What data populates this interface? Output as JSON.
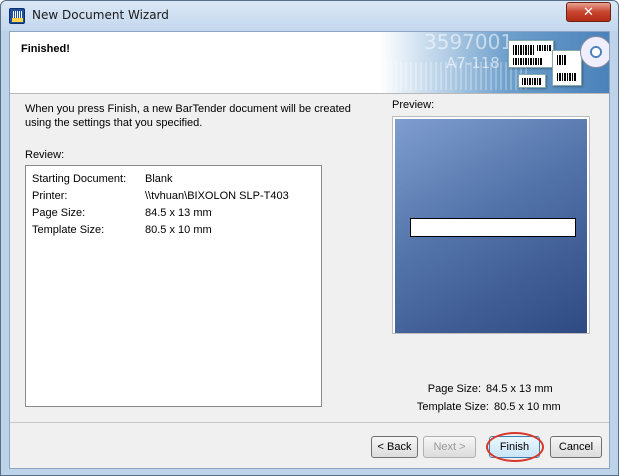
{
  "window": {
    "title": "New Document Wizard",
    "close_glyph": "✕"
  },
  "header": {
    "title": "Finished!",
    "banner_text_1": "3597001",
    "banner_text_2": "A7-118"
  },
  "main": {
    "description": "When you press Finish, a new BarTender document will be created using the settings that you specified.",
    "review_label": "Review:",
    "review_rows": [
      {
        "key": "Starting Document:",
        "value": "Blank"
      },
      {
        "key": "Printer:",
        "value": "\\\\tvhuan\\BIXOLON SLP-T403"
      },
      {
        "key": "Page Size:",
        "value": "84.5 x 13 mm"
      },
      {
        "key": "Template Size:",
        "value": "80.5 x 10 mm"
      }
    ]
  },
  "preview": {
    "label": "Preview:",
    "page_size_label": "Page Size:",
    "page_size_value": "84.5 x 13 mm",
    "template_size_label": "Template Size:",
    "template_size_value": "80.5 x 10 mm"
  },
  "buttons": {
    "back": "< Back",
    "next": "Next >",
    "finish": "Finish",
    "cancel": "Cancel"
  },
  "colors": {
    "highlight": "#d8382b",
    "preview_top": "#7f9dcf",
    "preview_bottom": "#2f4a82"
  },
  "icons": {
    "app": "bartender-app-icon",
    "close": "close-icon"
  }
}
